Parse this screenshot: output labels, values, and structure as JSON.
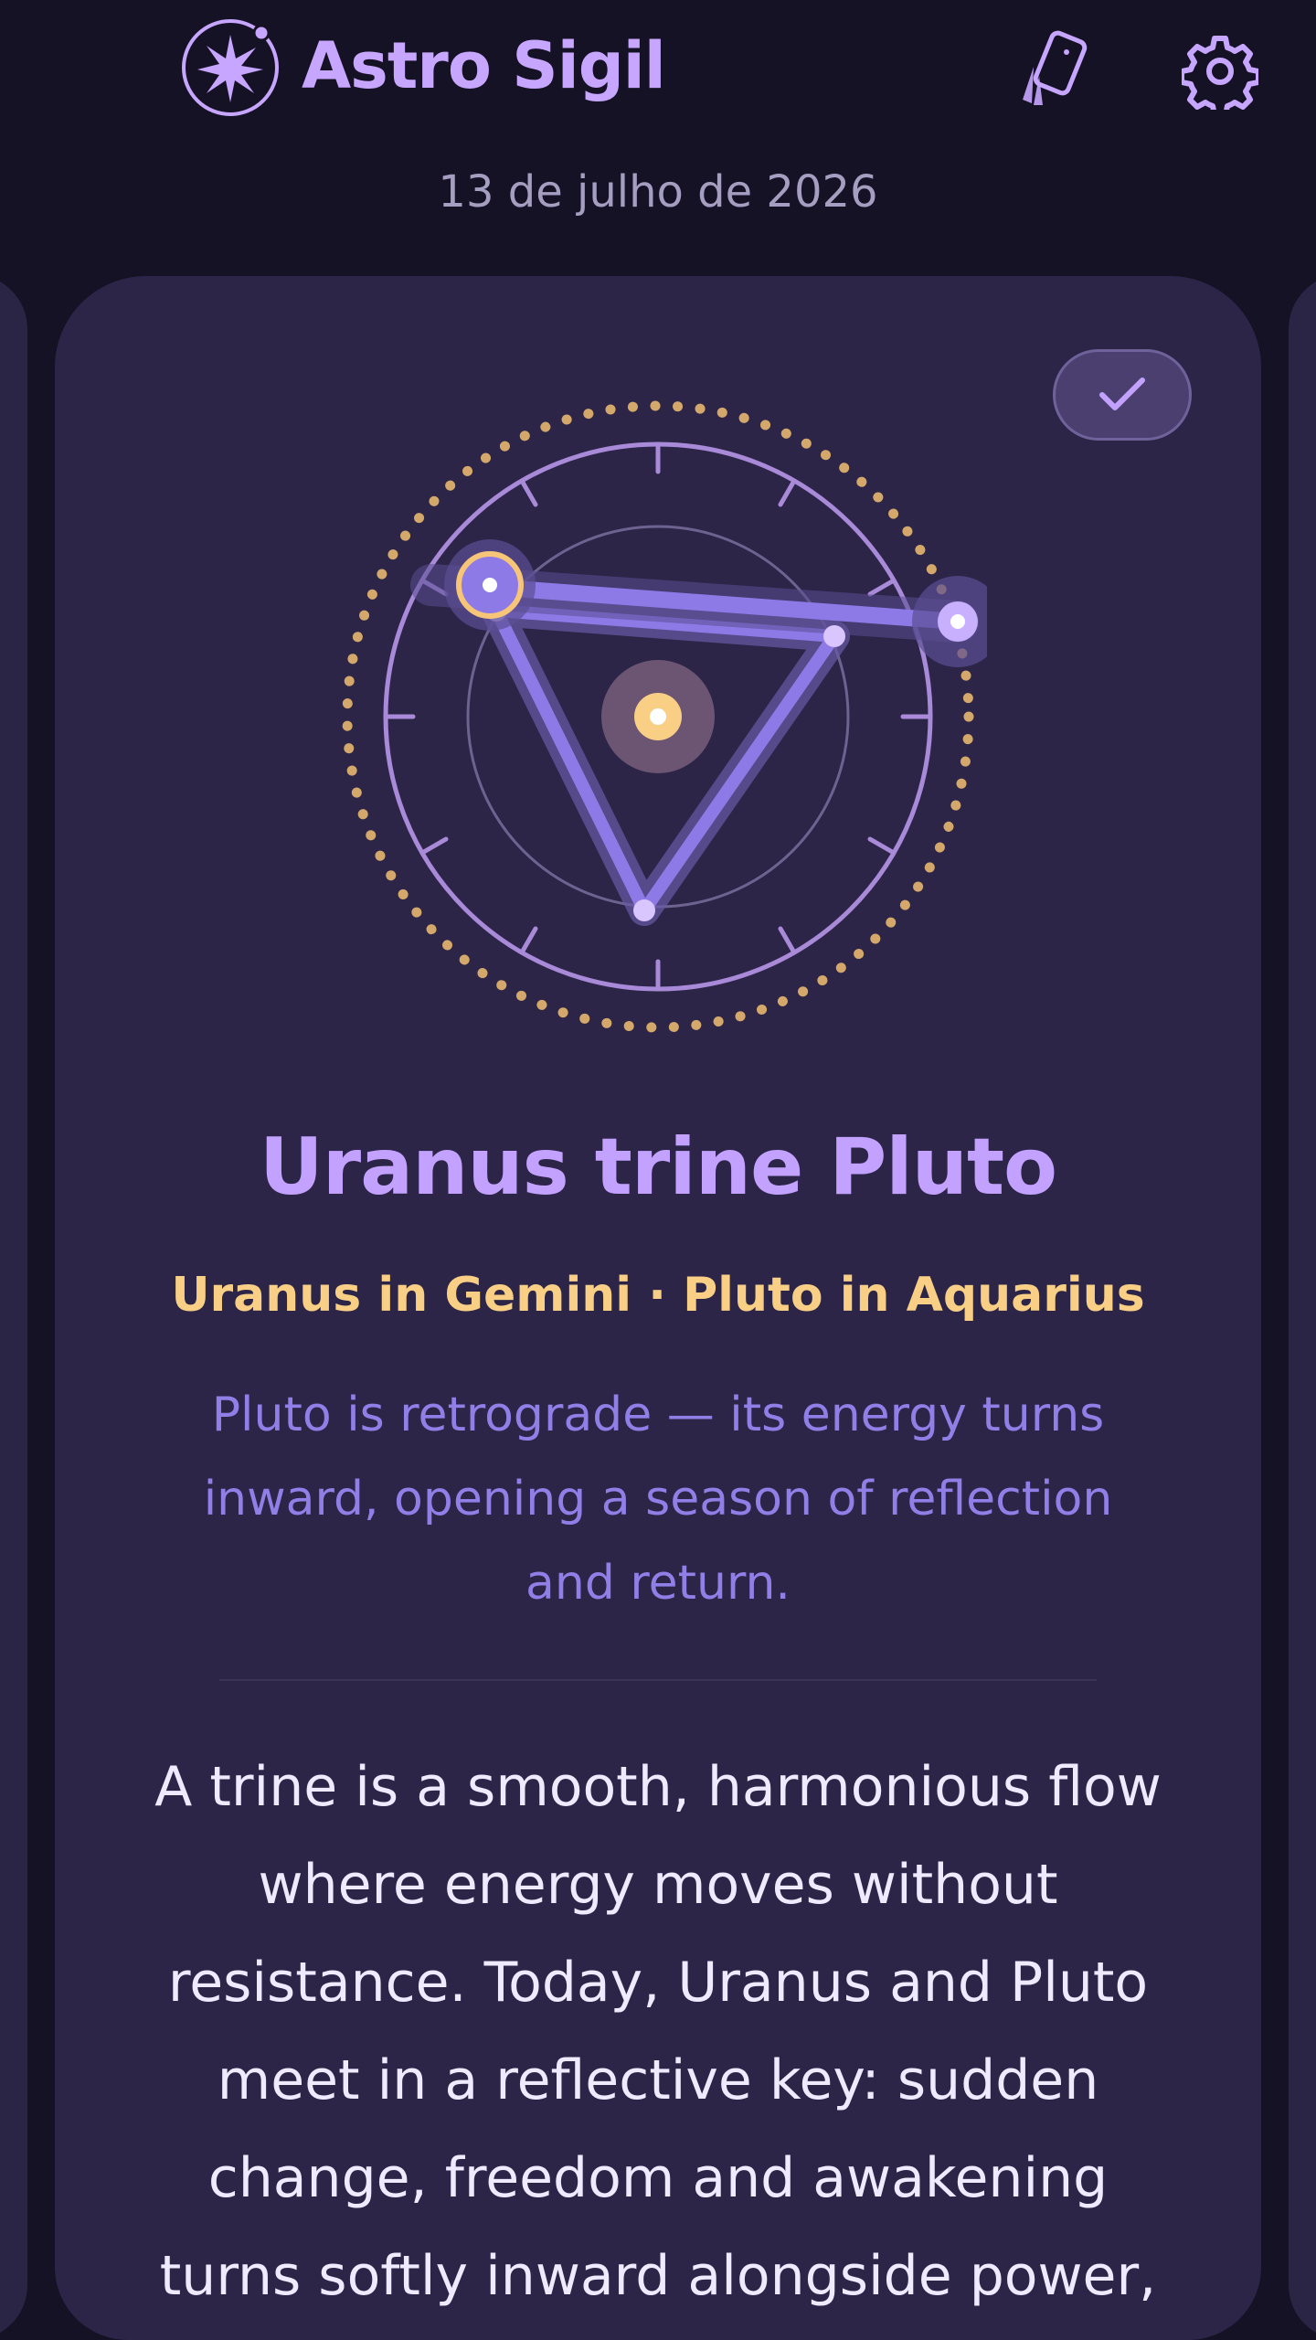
{
  "header": {
    "app_title": "Astro Sigil",
    "logo_icon": "sparkle-orbit-icon",
    "cards_icon": "tarot-cards-icon",
    "settings_icon": "gear-icon"
  },
  "date": "13 de julho de 2026",
  "card": {
    "done_icon": "check-icon",
    "title": "Uranus trine Pluto",
    "subtitle": "Uranus in Gemini · Pluto in Aquarius",
    "note": "Pluto is retrograde — its energy turns inward, opening a season of reflection and return.",
    "body": "A trine is a smooth, harmonious flow where energy moves without resistance. Today, Uranus and Pluto meet in a reflective key: sudden change, freedom and awakening turns softly inward alongside power,"
  },
  "colors": {
    "background": "#161226",
    "card": "#2c2548",
    "accent_purple": "#c3a2ff",
    "accent_gold": "#f8cf85",
    "note_purple": "#8f7fe6"
  }
}
